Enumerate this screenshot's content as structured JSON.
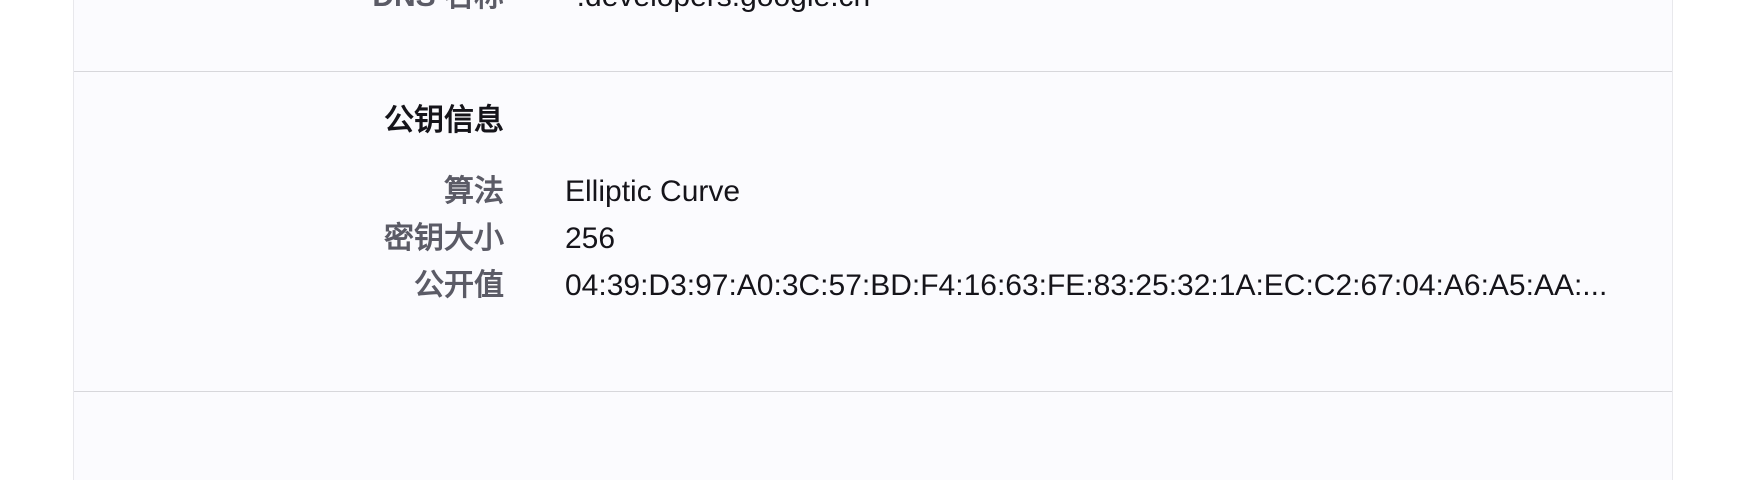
{
  "previous_section": {
    "rows": [
      {
        "label": "DNS 名称",
        "value": "*.developers.google.cn"
      }
    ]
  },
  "public_key_info": {
    "heading": "公钥信息",
    "rows": [
      {
        "label": "算法",
        "value": "Elliptic Curve"
      },
      {
        "label": "密钥大小",
        "value": "256"
      },
      {
        "label": "公开值",
        "value": "04:39:D3:97:A0:3C:57:BD:F4:16:63:FE:83:25:32:1A:EC:C2:67:04:A6:A5:AA:..."
      }
    ]
  }
}
